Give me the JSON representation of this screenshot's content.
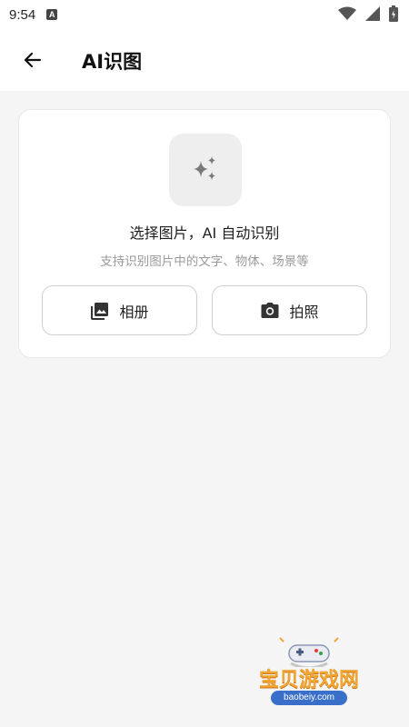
{
  "status_bar": {
    "time": "9:54",
    "app_icon_letter": "A"
  },
  "app_bar": {
    "title": "AI识图"
  },
  "card": {
    "title": "选择图片，AI 自动识别",
    "subtitle": "支持识别图片中的文字、物体、场景等",
    "album_label": "相册",
    "camera_label": "拍照"
  },
  "watermark": {
    "name": "宝贝游戏网",
    "url": "baobeiy.com"
  },
  "icons": {
    "back": "arrow-left",
    "hero": "sparkles",
    "album": "photo-library",
    "camera": "camera"
  }
}
